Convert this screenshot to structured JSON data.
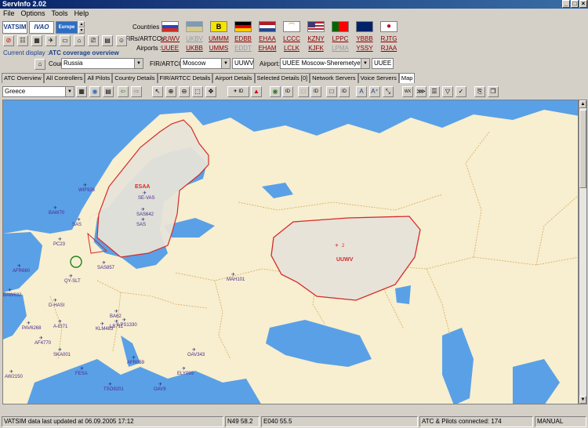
{
  "window": {
    "title": "ServInfo 2.02"
  },
  "menu": [
    "File",
    "Options",
    "Tools",
    "Help"
  ],
  "logos": {
    "vatsim": "VATSIM",
    "ivao": "IVAO",
    "europe": "Europe"
  },
  "labels": {
    "countries": "Countries :",
    "firs": "FIRs/ARTCCs :",
    "airports": "Airports :",
    "current_display": "Current display :",
    "current_display_value": "ATC coverage overview"
  },
  "firs": [
    {
      "code": "UUWV",
      "gray": false
    },
    {
      "code": "UKBV",
      "gray": true
    },
    {
      "code": "UMMM",
      "gray": false
    },
    {
      "code": "EDBB",
      "gray": false
    },
    {
      "code": "EHAA",
      "gray": false
    },
    {
      "code": "LCCC",
      "gray": false
    },
    {
      "code": "KZNY",
      "gray": false
    },
    {
      "code": "LPPC",
      "gray": false
    },
    {
      "code": "YBBB",
      "gray": false
    },
    {
      "code": "RJTG",
      "gray": false
    }
  ],
  "airports": [
    {
      "code": "UUEE",
      "gray": false
    },
    {
      "code": "UKBB",
      "gray": false
    },
    {
      "code": "UMMS",
      "gray": false
    },
    {
      "code": "EDDT",
      "gray": true
    },
    {
      "code": "EHAM",
      "gray": false
    },
    {
      "code": "LCLK",
      "gray": false
    },
    {
      "code": "KJFK",
      "gray": false
    },
    {
      "code": "LPMA",
      "gray": true
    },
    {
      "code": "YSSY",
      "gray": false
    },
    {
      "code": "RJAA",
      "gray": false
    }
  ],
  "selectors": {
    "country_label": "Country:",
    "country": "Russia",
    "fir_label": "FIR/ARTCC:",
    "fir": "Moscow",
    "fir_code": "UUWV",
    "airport_label": "Airport:",
    "airport": "UUEE Moscow-Sheremetyev",
    "airport_code": "UUEE"
  },
  "tabs": [
    "ATC Overview",
    "All Controllers",
    "All Pilots",
    "Country Details",
    "FIR/ARTCC Details",
    "Airport Details",
    "Selected Details [0]",
    "Network Servers",
    "Voice Servers",
    "Map"
  ],
  "map_toolbar": {
    "region": "Greece"
  },
  "map": {
    "fir_labels": [
      "ESAA",
      "UUWV"
    ],
    "callsigns": [
      "WIF926",
      "BAW70",
      "SE-VAS",
      "SAS",
      "SAS642",
      "SAS",
      "PC23",
      "AFR660",
      "BAW632",
      "QY-SLT",
      "D-HASI",
      "LB711",
      "BA62",
      "LPS1330",
      "KLM483",
      "PAV6268",
      "A-EI71",
      "AF4770",
      "SKA001",
      "AFR059",
      "OAV343",
      "FESA",
      "ELY099",
      "AW2150",
      "TSO9201",
      "OAV9",
      "SAS857",
      "MAH101"
    ],
    "sector_label": "2"
  },
  "status": {
    "last_update": "VATSIM data last updated at 06.09.2005 17:12",
    "lat": "N49 58.2",
    "lon": "E040 55.5",
    "connected": "ATC & Pilots connected: 174",
    "mode": "MANUAL"
  },
  "colors": {
    "sea": "#5aa0e6",
    "land": "#f7efcf",
    "fir_border": "#d62a2a",
    "fir_fill": "#e7e3d8",
    "border": "#d8a860"
  }
}
